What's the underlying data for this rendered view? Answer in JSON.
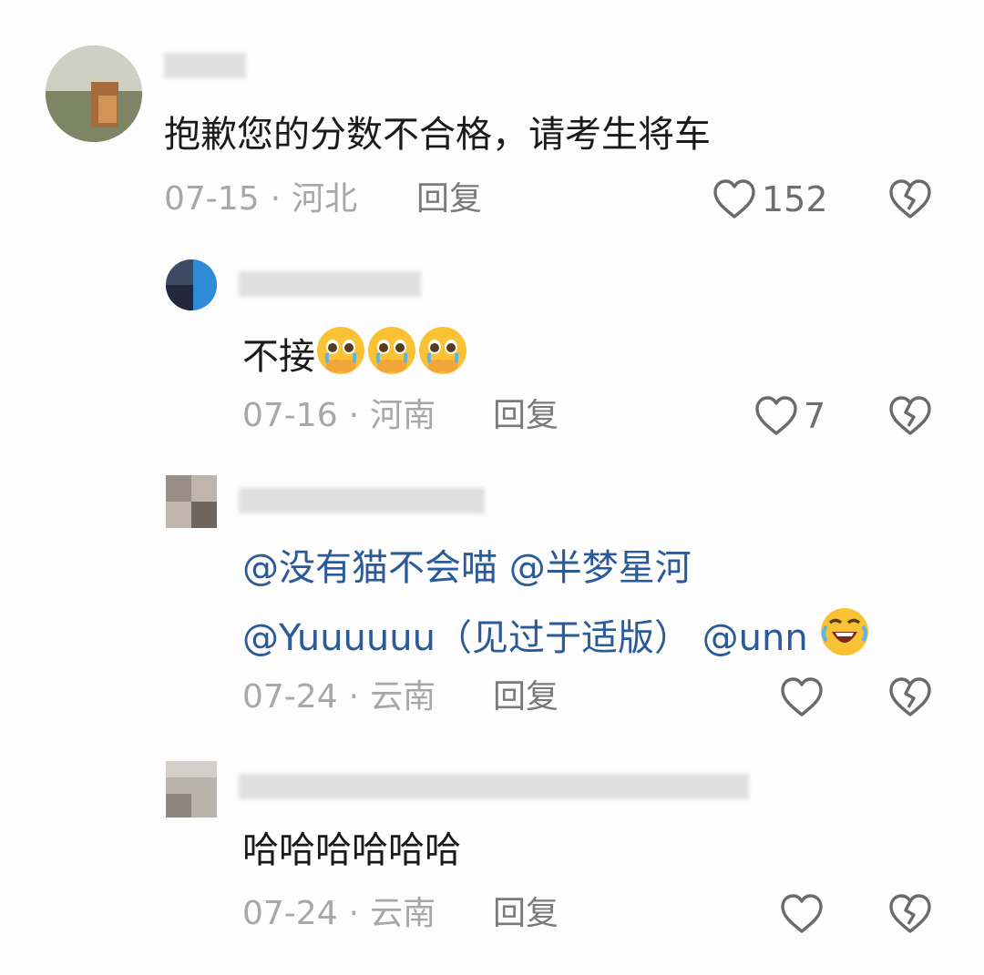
{
  "comments": [
    {
      "text": "抱歉您的分数不合格，请考生将车",
      "date": "07-15",
      "location": "河北",
      "reply_label": "回复",
      "likes": "152"
    },
    {
      "text": "不接",
      "emoji": [
        "pleading-crying-face",
        "pleading-crying-face",
        "pleading-crying-face"
      ],
      "date": "07-16",
      "location": "河南",
      "reply_label": "回复",
      "likes": "7"
    },
    {
      "line1": "@没有猫不会喵 @半梦星河",
      "line2": "@Yuuuuuu（见过于适版） @unn",
      "emoji": [
        "rolling-laughing-face"
      ],
      "date": "07-24",
      "location": "云南",
      "reply_label": "回复",
      "likes": ""
    },
    {
      "text": "哈哈哈哈哈哈",
      "date": "07-24",
      "location": "云南",
      "reply_label": "回复",
      "likes": ""
    }
  ],
  "separator": "·",
  "colors": {
    "mention": "#2a5a9a",
    "text": "#1a1a1a",
    "meta": "#a7a7a7"
  },
  "icons": {
    "like": "heart-outline-icon",
    "dislike": "broken-heart-icon"
  }
}
